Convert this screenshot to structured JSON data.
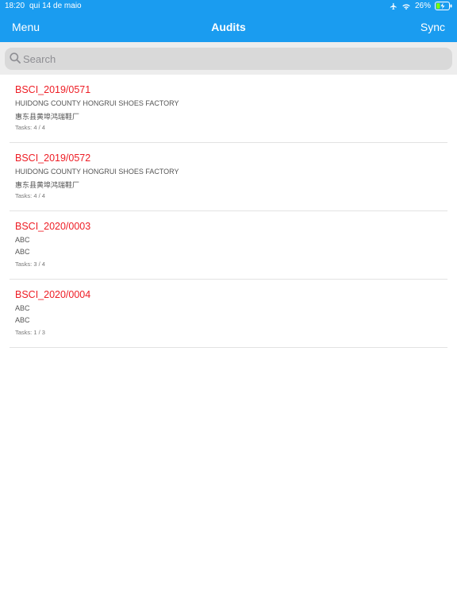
{
  "status_bar": {
    "time": "18:20",
    "date": "qui 14 de maio",
    "battery": "26%",
    "icons": [
      "airplane-icon",
      "wifi-icon",
      "battery-charging-icon"
    ]
  },
  "navbar": {
    "left_label": "Menu",
    "title": "Audits",
    "right_label": "Sync",
    "color": "#1a9cf0"
  },
  "search": {
    "placeholder": "Search",
    "value": ""
  },
  "audits": [
    {
      "code": "BSCI_2019/0571",
      "line1": "HUIDONG COUNTY HONGRUI SHOES FACTORY",
      "line2": "惠东县黄埠鸿瑞鞋厂",
      "tasks": "Tasks: 4 / 4"
    },
    {
      "code": "BSCI_2019/0572",
      "line1": "HUIDONG COUNTY HONGRUI SHOES FACTORY",
      "line2": "惠东县黄埠鸿瑞鞋厂",
      "tasks": "Tasks: 4 / 4"
    },
    {
      "code": "BSCI_2020/0003",
      "line1": "ABC",
      "line2": "ABC",
      "tasks": "Tasks: 3 / 4"
    },
    {
      "code": "BSCI_2020/0004",
      "line1": "ABC",
      "line2": "ABC",
      "tasks": "Tasks: 1 / 3"
    }
  ],
  "colors": {
    "code_text": "#ee1c24"
  }
}
